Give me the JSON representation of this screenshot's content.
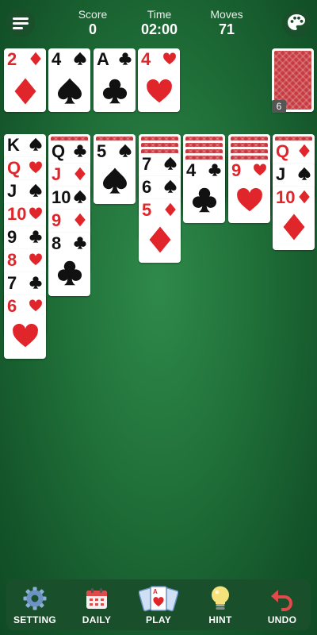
{
  "header": {
    "score_label": "Score",
    "score": "0",
    "time_label": "Time",
    "time": "02:00",
    "moves_label": "Moves",
    "moves": "71"
  },
  "foundations": [
    {
      "rank": "2",
      "suit": "diamond",
      "color": "red"
    },
    {
      "rank": "4",
      "suit": "spade",
      "color": "black"
    },
    {
      "rank": "A",
      "suit": "club",
      "color": "black"
    },
    {
      "rank": "4",
      "suit": "heart",
      "color": "red"
    }
  ],
  "stock": {
    "count": "6"
  },
  "tableau": [
    {
      "hidden": 0,
      "cards": [
        {
          "rank": "K",
          "suit": "spade",
          "color": "black"
        },
        {
          "rank": "Q",
          "suit": "heart",
          "color": "red"
        },
        {
          "rank": "J",
          "suit": "spade",
          "color": "black"
        },
        {
          "rank": "10",
          "suit": "heart",
          "color": "red"
        },
        {
          "rank": "9",
          "suit": "club",
          "color": "black"
        },
        {
          "rank": "8",
          "suit": "heart",
          "color": "red"
        },
        {
          "rank": "7",
          "suit": "club",
          "color": "black"
        },
        {
          "rank": "6",
          "suit": "heart",
          "color": "red"
        }
      ]
    },
    {
      "hidden": 1,
      "cards": [
        {
          "rank": "Q",
          "suit": "club",
          "color": "black"
        },
        {
          "rank": "J",
          "suit": "diamond",
          "color": "red"
        },
        {
          "rank": "10",
          "suit": "spade",
          "color": "black"
        },
        {
          "rank": "9",
          "suit": "diamond",
          "color": "red"
        },
        {
          "rank": "8",
          "suit": "club",
          "color": "black"
        }
      ]
    },
    {
      "hidden": 1,
      "cards": [
        {
          "rank": "5",
          "suit": "spade",
          "color": "black"
        }
      ]
    },
    {
      "hidden": 3,
      "cards": [
        {
          "rank": "7",
          "suit": "spade",
          "color": "black"
        },
        {
          "rank": "6",
          "suit": "spade",
          "color": "black"
        },
        {
          "rank": "5",
          "suit": "diamond",
          "color": "red"
        }
      ]
    },
    {
      "hidden": 4,
      "cards": [
        {
          "rank": "4",
          "suit": "club",
          "color": "black"
        }
      ]
    },
    {
      "hidden": 4,
      "cards": [
        {
          "rank": "9",
          "suit": "heart",
          "color": "red"
        }
      ]
    },
    {
      "hidden": 1,
      "cards": [
        {
          "rank": "Q",
          "suit": "diamond",
          "color": "red"
        },
        {
          "rank": "J",
          "suit": "spade",
          "color": "black"
        },
        {
          "rank": "10",
          "suit": "diamond",
          "color": "red"
        }
      ]
    }
  ],
  "toolbar": {
    "setting": "SETTING",
    "daily": "DAILY",
    "play": "PLAY",
    "hint": "HINT",
    "undo": "UNDO"
  },
  "colors": {
    "felt": "#1f6e38",
    "red_suit": "#e0262b",
    "card_back": "#c73a3f"
  }
}
